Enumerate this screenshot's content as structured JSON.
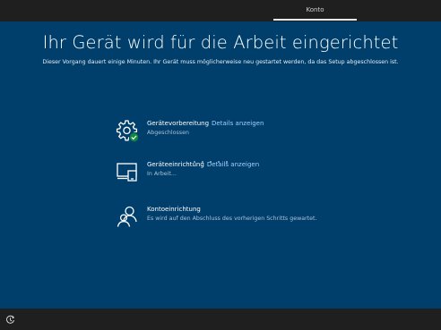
{
  "header": {
    "tab_label": "Konto"
  },
  "main": {
    "title": "Ihr Gerät wird für die Arbeit eingerichtet",
    "subtitle": "Dieser Vorgang dauert einige Minuten. Ihr Gerät muss möglicherweise neu gestartet werden, da das Setup abgeschlossen ist.",
    "steps": [
      {
        "name": "Gerätevorbereitung",
        "link": "Details anzeigen",
        "status": "Abgeschlossen",
        "icon": "gear-check-icon"
      },
      {
        "name": "Geräteeinrichtung",
        "link": "Details anzeigen",
        "status": "In Arbeit...",
        "icon": "device-icon"
      },
      {
        "name": "Kontoeinrichtung",
        "link": "",
        "status": "Es wird auf den Abschluss des vorherigen Schritts gewartet.",
        "icon": "account-icon"
      }
    ]
  },
  "footer": {
    "accessibility_icon": "ease-of-access-icon"
  },
  "colors": {
    "background": "#003f6b",
    "bars": "#1f1f1f",
    "link": "#9fd0ff",
    "success": "#10893e"
  }
}
